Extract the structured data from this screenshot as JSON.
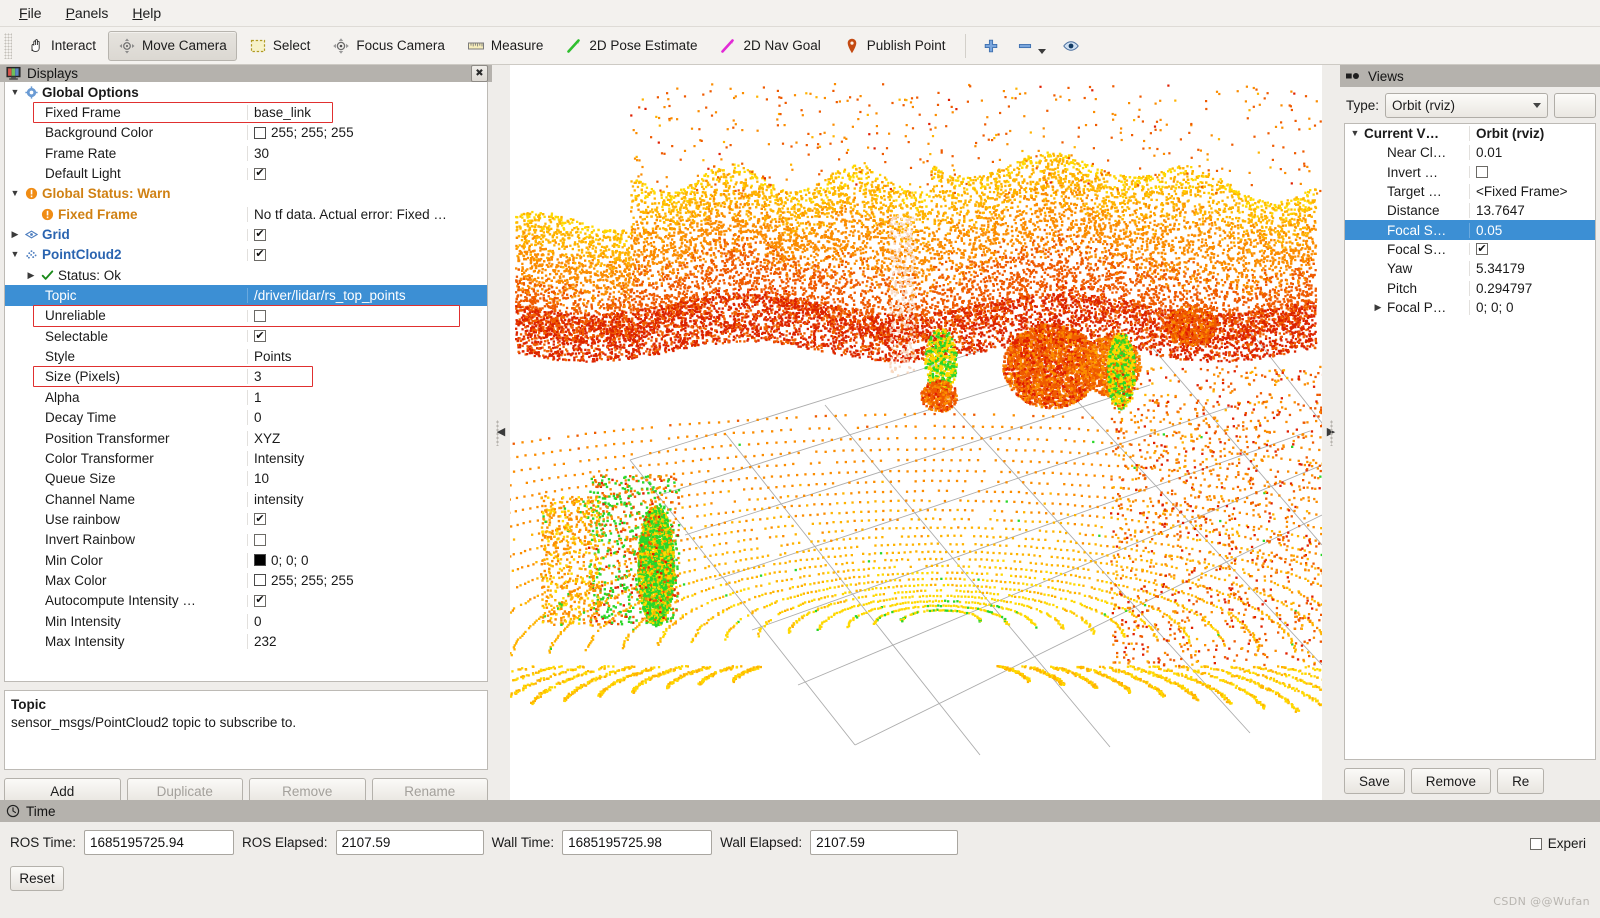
{
  "menu": {
    "items": [
      {
        "label": "File",
        "mnemonic": "F"
      },
      {
        "label": "Panels",
        "mnemonic": "P"
      },
      {
        "label": "Help",
        "mnemonic": "H"
      }
    ]
  },
  "toolbar": {
    "buttons": [
      {
        "label": "Interact",
        "icon": "hand-icon",
        "checked": false
      },
      {
        "label": "Move Camera",
        "icon": "move-camera-icon",
        "checked": true
      },
      {
        "label": "Select",
        "icon": "select-rect-icon",
        "checked": false
      },
      {
        "label": "Focus Camera",
        "icon": "focus-camera-icon",
        "checked": false
      },
      {
        "label": "Measure",
        "icon": "ruler-icon",
        "checked": false
      },
      {
        "label": "2D Pose Estimate",
        "icon": "green-arrow-icon",
        "checked": false
      },
      {
        "label": "2D Nav Goal",
        "icon": "magenta-arrow-icon",
        "checked": false
      },
      {
        "label": "Publish Point",
        "icon": "map-pin-icon",
        "checked": false
      }
    ],
    "small_buttons": [
      {
        "icon": "plus-icon",
        "label": "+"
      },
      {
        "icon": "minus-icon",
        "label": "–"
      },
      {
        "icon": "eye-icon",
        "label": "◉"
      }
    ]
  },
  "displays": {
    "title": "Displays",
    "close_label": "✖",
    "rows": [
      {
        "indent": 0,
        "twisty": "▼",
        "icon": "gear-icon",
        "name": "Global Options",
        "value": "",
        "kind": "category"
      },
      {
        "indent": 1,
        "twisty": "",
        "icon": "",
        "name": "Fixed Frame",
        "value": "base_link",
        "kind": "text"
      },
      {
        "indent": 1,
        "twisty": "",
        "icon": "",
        "name": "Background Color",
        "value": "255; 255; 255",
        "kind": "color",
        "swatch": "#ffffff"
      },
      {
        "indent": 1,
        "twisty": "",
        "icon": "",
        "name": "Frame Rate",
        "value": "30",
        "kind": "text"
      },
      {
        "indent": 1,
        "twisty": "",
        "icon": "",
        "name": "Default Light",
        "value": "",
        "kind": "check",
        "checked": true
      },
      {
        "indent": 0,
        "twisty": "▼",
        "icon": "warn-icon",
        "name": "Global Status: Warn",
        "value": "",
        "kind": "warn"
      },
      {
        "indent": 1,
        "twisty": "",
        "icon": "warn-icon",
        "name": "Fixed Frame",
        "value": "No tf data.  Actual error: Fixed …",
        "kind": "warn-child"
      },
      {
        "indent": 0,
        "twisty": "▶",
        "icon": "grid-icon",
        "name": "Grid",
        "value": "",
        "kind": "display",
        "checked": true
      },
      {
        "indent": 0,
        "twisty": "▼",
        "icon": "pointcloud-icon",
        "name": "PointCloud2",
        "value": "",
        "kind": "display",
        "checked": true
      },
      {
        "indent": 1,
        "twisty": "▶",
        "icon": "ok-icon",
        "name": "Status: Ok",
        "value": "",
        "kind": "status"
      },
      {
        "indent": 1,
        "twisty": "",
        "icon": "",
        "name": "Topic",
        "value": "/driver/lidar/rs_top_points",
        "kind": "text",
        "selected": true
      },
      {
        "indent": 1,
        "twisty": "",
        "icon": "",
        "name": "Unreliable",
        "value": "",
        "kind": "check",
        "checked": false
      },
      {
        "indent": 1,
        "twisty": "",
        "icon": "",
        "name": "Selectable",
        "value": "",
        "kind": "check",
        "checked": true
      },
      {
        "indent": 1,
        "twisty": "",
        "icon": "",
        "name": "Style",
        "value": "Points",
        "kind": "text"
      },
      {
        "indent": 1,
        "twisty": "",
        "icon": "",
        "name": "Size (Pixels)",
        "value": "3",
        "kind": "text"
      },
      {
        "indent": 1,
        "twisty": "",
        "icon": "",
        "name": "Alpha",
        "value": "1",
        "kind": "text"
      },
      {
        "indent": 1,
        "twisty": "",
        "icon": "",
        "name": "Decay Time",
        "value": "0",
        "kind": "text"
      },
      {
        "indent": 1,
        "twisty": "",
        "icon": "",
        "name": "Position Transformer",
        "value": "XYZ",
        "kind": "text"
      },
      {
        "indent": 1,
        "twisty": "",
        "icon": "",
        "name": "Color Transformer",
        "value": "Intensity",
        "kind": "text"
      },
      {
        "indent": 1,
        "twisty": "",
        "icon": "",
        "name": "Queue Size",
        "value": "10",
        "kind": "text"
      },
      {
        "indent": 1,
        "twisty": "",
        "icon": "",
        "name": "Channel Name",
        "value": "intensity",
        "kind": "text"
      },
      {
        "indent": 1,
        "twisty": "",
        "icon": "",
        "name": "Use rainbow",
        "value": "",
        "kind": "check",
        "checked": true
      },
      {
        "indent": 1,
        "twisty": "",
        "icon": "",
        "name": "Invert Rainbow",
        "value": "",
        "kind": "check",
        "checked": false
      },
      {
        "indent": 1,
        "twisty": "",
        "icon": "",
        "name": "Min Color",
        "value": "0; 0; 0",
        "kind": "color",
        "swatch": "#000000"
      },
      {
        "indent": 1,
        "twisty": "",
        "icon": "",
        "name": "Max Color",
        "value": "255; 255; 255",
        "kind": "color",
        "swatch": "#ffffff"
      },
      {
        "indent": 1,
        "twisty": "",
        "icon": "",
        "name": "Autocompute Intensity …",
        "value": "",
        "kind": "check",
        "checked": true
      },
      {
        "indent": 1,
        "twisty": "",
        "icon": "",
        "name": "Min Intensity",
        "value": "0",
        "kind": "text"
      },
      {
        "indent": 1,
        "twisty": "",
        "icon": "",
        "name": "Max Intensity",
        "value": "232",
        "kind": "text"
      }
    ],
    "description": {
      "title": "Topic",
      "body": "sensor_msgs/PointCloud2 topic to subscribe to."
    },
    "buttons": [
      {
        "label": "Add",
        "disabled": false
      },
      {
        "label": "Duplicate",
        "disabled": true
      },
      {
        "label": "Remove",
        "disabled": true
      },
      {
        "label": "Rename",
        "disabled": true
      }
    ]
  },
  "views": {
    "title": "Views",
    "type_label": "Type:",
    "type_value": "Orbit (rviz)",
    "rows": [
      {
        "indent": 0,
        "twisty": "▼",
        "name": "Current V…",
        "value": "Orbit (rviz)",
        "kind": "category"
      },
      {
        "indent": 1,
        "twisty": "",
        "name": "Near Cl…",
        "value": "0.01",
        "kind": "text"
      },
      {
        "indent": 1,
        "twisty": "",
        "name": "Invert …",
        "value": "",
        "kind": "check",
        "checked": false
      },
      {
        "indent": 1,
        "twisty": "",
        "name": "Target …",
        "value": "<Fixed Frame>",
        "kind": "text"
      },
      {
        "indent": 1,
        "twisty": "",
        "name": "Distance",
        "value": "13.7647",
        "kind": "text"
      },
      {
        "indent": 1,
        "twisty": "",
        "name": "Focal S…",
        "value": "0.05",
        "kind": "text",
        "selected": true
      },
      {
        "indent": 1,
        "twisty": "",
        "name": "Focal S…",
        "value": "",
        "kind": "check",
        "checked": true
      },
      {
        "indent": 1,
        "twisty": "",
        "name": "Yaw",
        "value": "5.34179",
        "kind": "text"
      },
      {
        "indent": 1,
        "twisty": "",
        "name": "Pitch",
        "value": "0.294797",
        "kind": "text"
      },
      {
        "indent": 1,
        "twisty": "▶",
        "name": "Focal P…",
        "value": "0; 0; 0",
        "kind": "text"
      }
    ],
    "buttons": [
      {
        "label": "Save"
      },
      {
        "label": "Remove"
      },
      {
        "label": "Re"
      }
    ]
  },
  "time": {
    "title": "Time",
    "fields": [
      {
        "label": "ROS Time:",
        "value": "1685195725.94"
      },
      {
        "label": "ROS Elapsed:",
        "value": "2107.59"
      },
      {
        "label": "Wall Time:",
        "value": "1685195725.98"
      },
      {
        "label": "Wall Elapsed:",
        "value": "2107.59"
      }
    ],
    "reset_label": "Reset",
    "experimental_label": "Experi",
    "experimental_checked": false
  },
  "watermark": "CSDN @@Wufan",
  "viewport": {
    "background": "#ffffff",
    "grid_color": "#9a9a9a",
    "colors": {
      "low": "#e02000",
      "mid": "#ff8c00",
      "high": "#ffd400",
      "top": "#22dd22"
    }
  }
}
